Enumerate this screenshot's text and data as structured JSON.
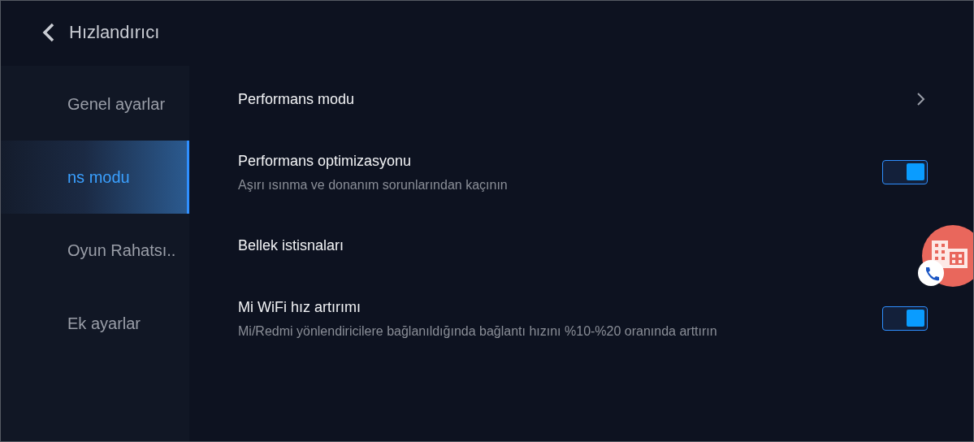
{
  "header": {
    "title": "Hızlandırıcı"
  },
  "sidebar": {
    "items": [
      {
        "label": "Genel ayarlar",
        "selected": false
      },
      {
        "label": "ns modu",
        "selected": true
      },
      {
        "label": "Oyun Rahatsı..",
        "selected": false
      },
      {
        "label": "Ek ayarlar",
        "selected": false
      }
    ]
  },
  "settings": [
    {
      "kind": "link",
      "title": "Performans modu"
    },
    {
      "kind": "toggle",
      "title": "Performans optimizasyonu",
      "subtitle": "Aşırı ısınma ve donanım sorunlarından kaçının",
      "on": true
    },
    {
      "kind": "plain",
      "title": "Bellek istisnaları"
    },
    {
      "kind": "toggle",
      "title": "Mi WiFi hız artırımı",
      "subtitle": "Mi/Redmi yönlendiricilere bağlanıldığında bağlantı hızını %10-%20 oranında arttırın",
      "on": true
    }
  ]
}
